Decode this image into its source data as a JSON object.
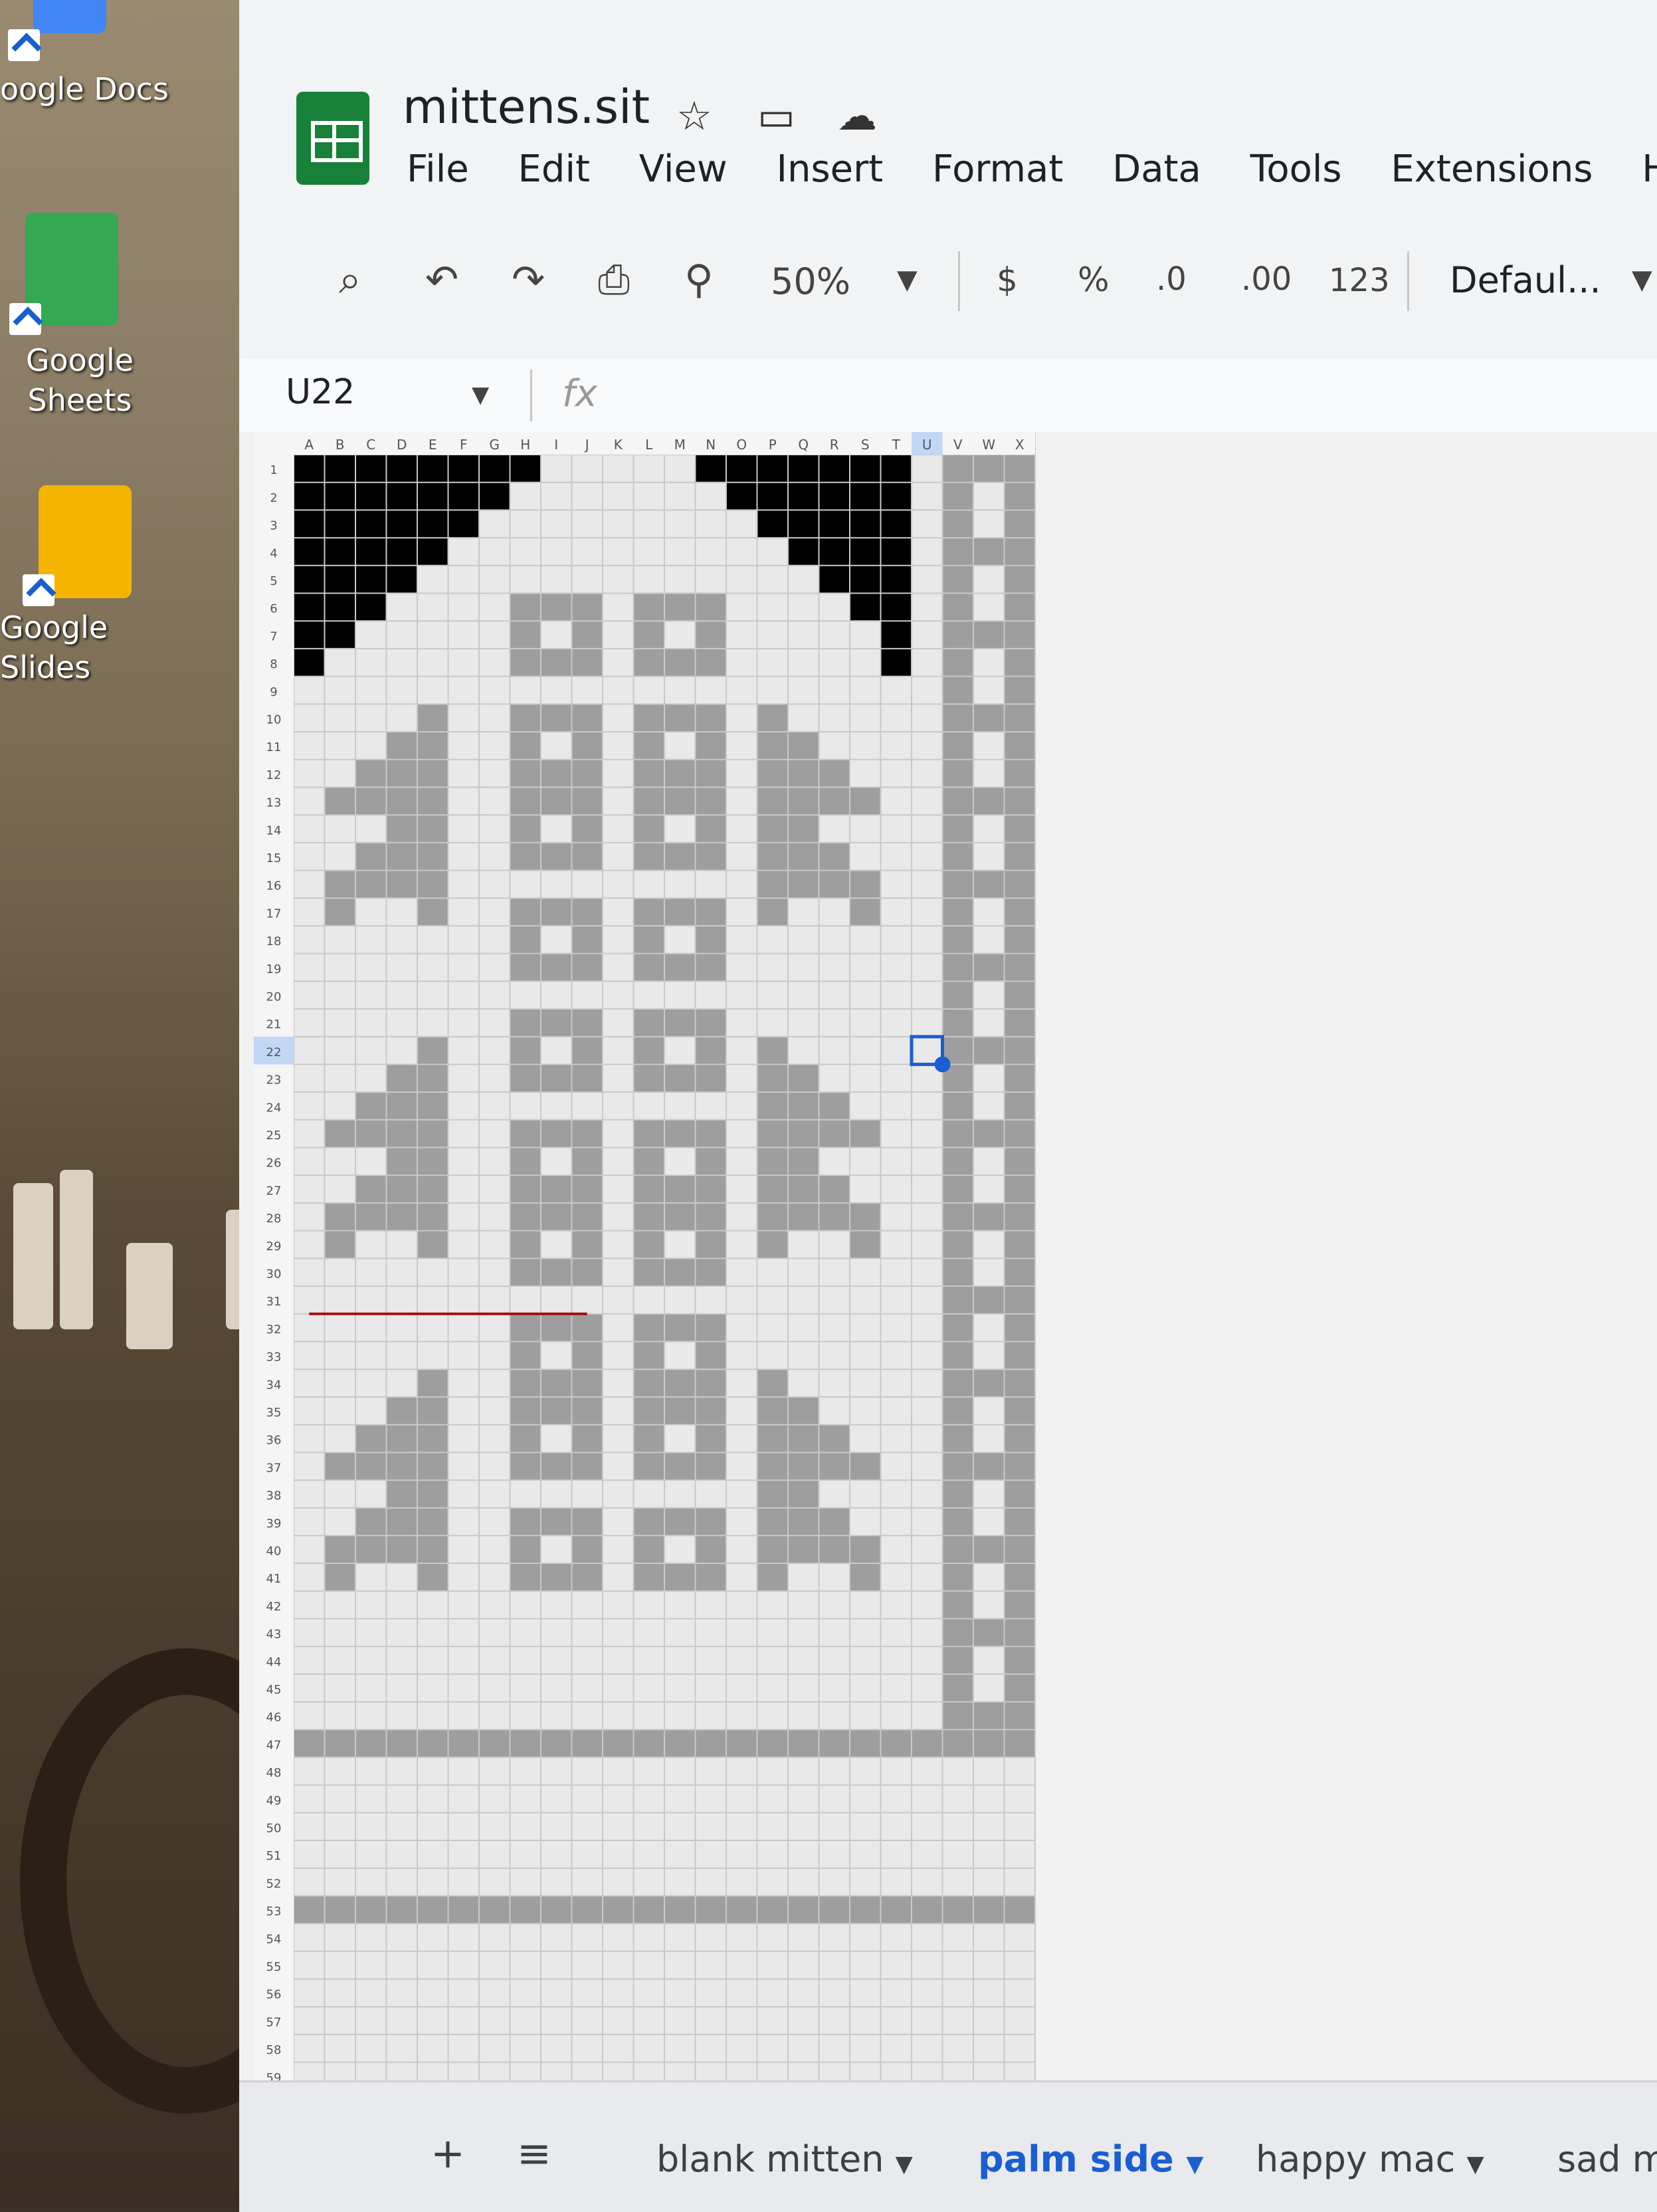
{
  "desktop": {
    "icons": [
      {
        "label": "oogle Docs"
      },
      {
        "label": "Google Sheets"
      },
      {
        "label": "Google Slides"
      }
    ]
  },
  "window": {
    "title": "mittens.sit",
    "menu": [
      "File",
      "Edit",
      "View",
      "Insert",
      "Format",
      "Data",
      "Tools",
      "Extensions",
      "Help"
    ],
    "toolbar": {
      "zoom": "50%",
      "currency": "$",
      "percent": "%",
      "dec_decrease": ".0",
      "dec_increase": ".00",
      "format_123": "123",
      "font": "Defaul..."
    },
    "name_box": "U22",
    "fx": "fx"
  },
  "sheet": {
    "columns": [
      "A",
      "B",
      "C",
      "D",
      "E",
      "F",
      "G",
      "H",
      "I",
      "J",
      "K",
      "L",
      "M",
      "N",
      "O",
      "P",
      "Q",
      "R",
      "S",
      "T",
      "U",
      "V",
      "W",
      "X"
    ],
    "rows": [
      "1",
      "2",
      "3",
      "4",
      "5",
      "6",
      "7",
      "8",
      "9",
      "10",
      "11",
      "12",
      "13",
      "14",
      "15",
      "16",
      "17",
      "18",
      "19",
      "20",
      "21",
      "22",
      "23",
      "24",
      "25",
      "26",
      "27",
      "28",
      "29",
      "30",
      "31",
      "32",
      "33",
      "34",
      "35",
      "36",
      "37",
      "38",
      "39",
      "40",
      "41",
      "42",
      "43",
      "44",
      "45",
      "46",
      "47",
      "48",
      "49",
      "50",
      "51",
      "52",
      "53",
      "54",
      "55",
      "56",
      "57",
      "58",
      "59"
    ],
    "selected_cell": "U22",
    "colors": {
      "fill": "#9e9e9e",
      "black": "#000000",
      "cell": "#e9e9e9",
      "line": "#c9c9c9",
      "selection": "#1a5fd1",
      "red_line": "#a01010"
    }
  },
  "tabs": {
    "add": "+",
    "list": "≡",
    "items": [
      {
        "label": "blank mitten",
        "active": false
      },
      {
        "label": "palm side",
        "active": true
      },
      {
        "label": "happy mac",
        "active": false
      },
      {
        "label": "sad m",
        "active": false
      }
    ]
  }
}
